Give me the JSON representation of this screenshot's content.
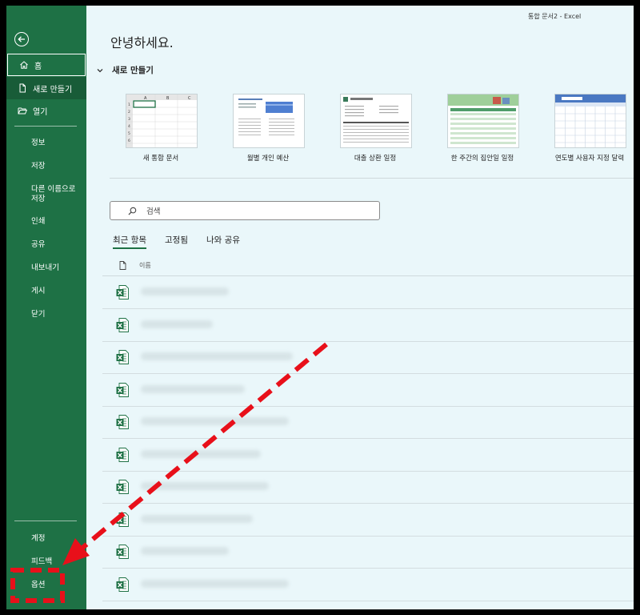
{
  "window": {
    "title": "통합 문서2  -  Excel"
  },
  "greeting": "안녕하세요.",
  "sidebar": {
    "items": [
      {
        "label": "홈"
      },
      {
        "label": "새로 만들기"
      },
      {
        "label": "열기"
      }
    ],
    "text_items": [
      {
        "label": "정보"
      },
      {
        "label": "저장"
      },
      {
        "label": "다른 이름으로\n저장"
      },
      {
        "label": "인쇄"
      },
      {
        "label": "공유"
      },
      {
        "label": "내보내기"
      },
      {
        "label": "게시"
      },
      {
        "label": "닫기"
      }
    ],
    "bottom_items": [
      {
        "label": "계정"
      },
      {
        "label": "피드백"
      },
      {
        "label": "옵션"
      }
    ]
  },
  "new_section": {
    "title": "새로 만들기",
    "templates": [
      {
        "label": "새 통합 문서"
      },
      {
        "label": "월별 개인 예산"
      },
      {
        "label": "대출 상환 일정"
      },
      {
        "label": "한 주간의 집안일 일정"
      },
      {
        "label": "연도별 사용자 지정 달력"
      }
    ]
  },
  "search": {
    "placeholder": "검색"
  },
  "tabs": [
    {
      "label": "최근 항목"
    },
    {
      "label": "고정됨"
    },
    {
      "label": "나와 공유"
    }
  ],
  "recent": {
    "column_name": "이름",
    "row_count": 10
  },
  "colors": {
    "sidebar": "#1e7145",
    "background": "#eaf7fa",
    "annotation": "#e8101a"
  }
}
